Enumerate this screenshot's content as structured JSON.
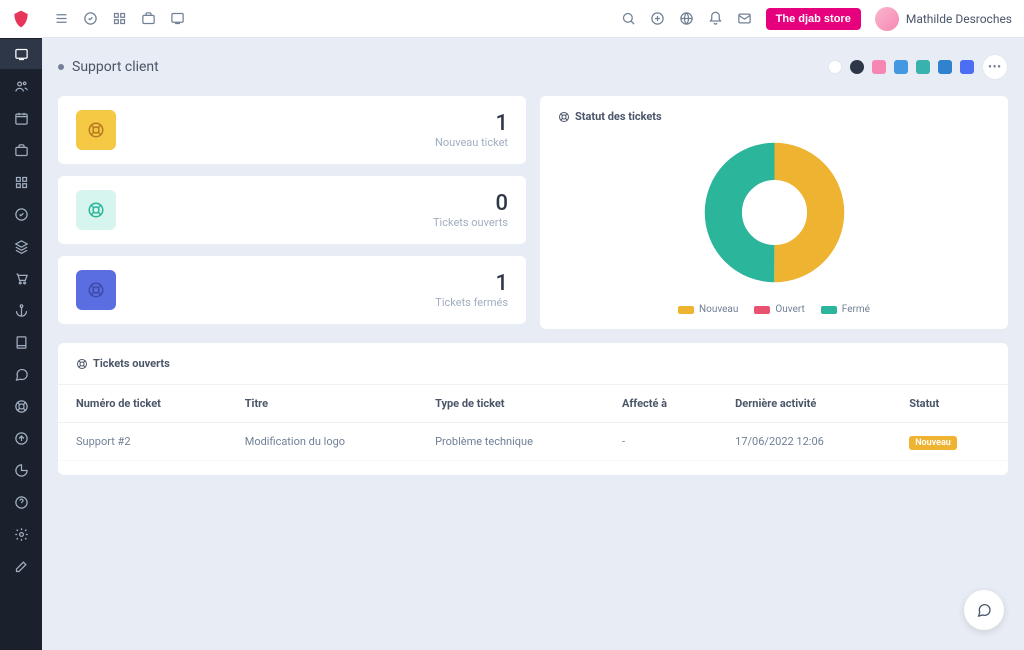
{
  "header": {
    "store_button": "The djab store",
    "username": "Mathilde Desroches"
  },
  "page": {
    "title": "Support client"
  },
  "theme_colors": [
    "#ffffff",
    "#2d3748",
    "#f687b3",
    "#4299e1",
    "#38b2ac",
    "#4299e1",
    "#4c6ef5"
  ],
  "stats": [
    {
      "value": "1",
      "label": "Nouveau ticket",
      "icon_bg": "#f6c945",
      "icon_color": "#b7791f"
    },
    {
      "value": "0",
      "label": "Tickets ouverts",
      "icon_bg": "#d6f5ef",
      "icon_color": "#2bb59a"
    },
    {
      "value": "1",
      "label": "Tickets fermés",
      "icon_bg": "#5b6ee1",
      "icon_color": "#3c4aa8"
    }
  ],
  "chart": {
    "title": "Statut des tickets"
  },
  "chart_data": {
    "type": "pie",
    "title": "Statut des tickets",
    "series": [
      {
        "name": "Nouveau",
        "value": 1,
        "color": "#eeb330"
      },
      {
        "name": "Ouvert",
        "value": 0,
        "color": "#e8526f"
      },
      {
        "name": "Fermé",
        "value": 1,
        "color": "#2bb59a"
      }
    ],
    "legend": [
      "Nouveau",
      "Ouvert",
      "Fermé"
    ]
  },
  "table": {
    "title": "Tickets ouverts",
    "columns": [
      "Numéro de ticket",
      "Titre",
      "Type de ticket",
      "Affecté à",
      "Dernière activité",
      "Statut"
    ],
    "rows": [
      {
        "num": "Support #2",
        "title": "Modification du logo",
        "type": "Problème technique",
        "assignee": "-",
        "activity": "17/06/2022 12:06",
        "status": "Nouveau"
      }
    ]
  }
}
